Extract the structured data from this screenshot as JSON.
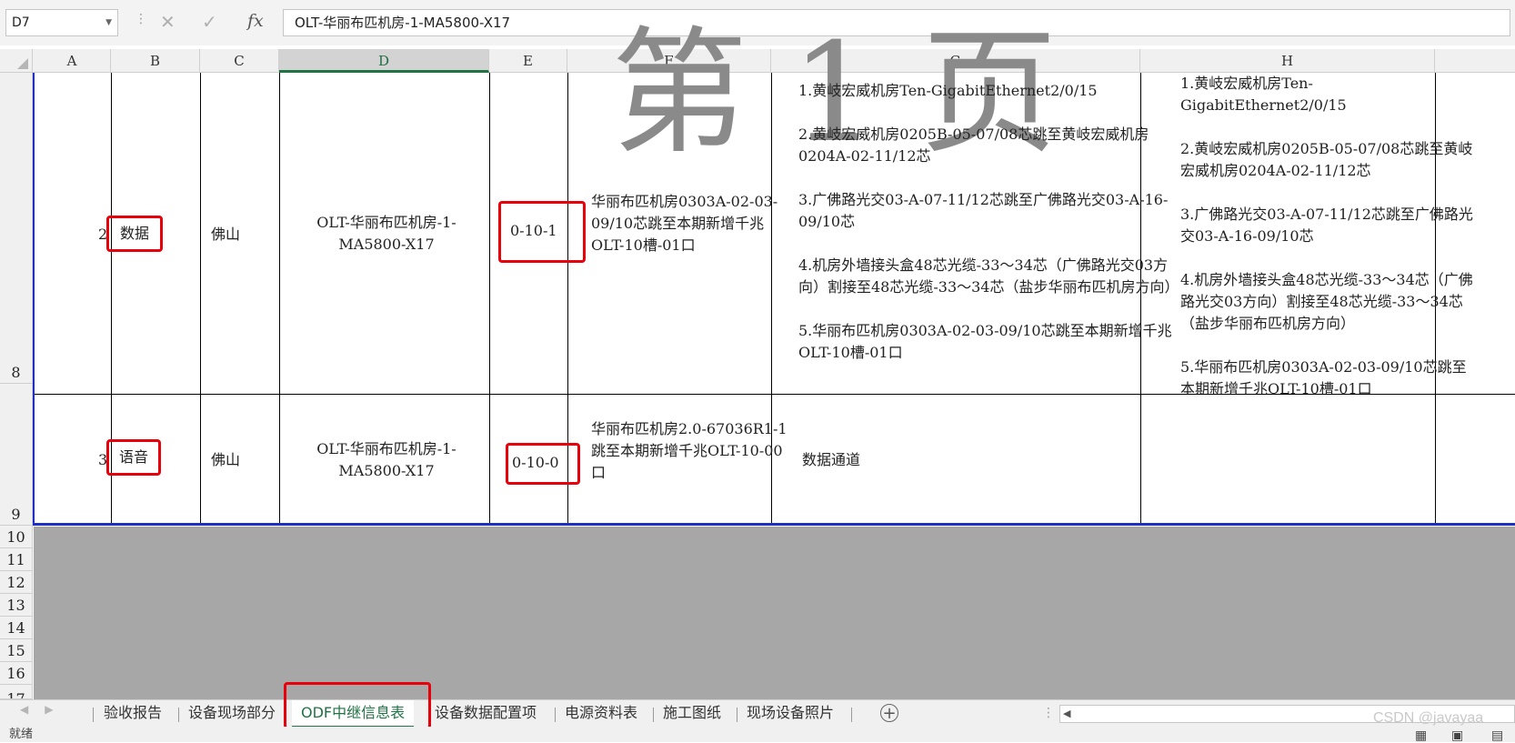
{
  "formula_bar": {
    "name_box": "D7",
    "cancel_icon": "✕",
    "enter_icon": "✓",
    "fx_label": "fx",
    "formula": "OLT-华丽布匹机房-1-MA5800-X17"
  },
  "columns": [
    "A",
    "B",
    "C",
    "D",
    "E",
    "F",
    "G",
    "H"
  ],
  "rows": {
    "r8": {
      "header": "8",
      "a": "2",
      "b": "数据",
      "c": "佛山",
      "d": "OLT-华丽布匹机房-1-MA5800-X17",
      "e": "0-10-1",
      "f": "华丽布匹机房0303A-02-03-09/10芯跳至本期新增千兆OLT-10槽-01口",
      "g": [
        "1.黄岐宏威机房Ten-GigabitEthernet2/0/15",
        "2.黄岐宏威机房0205B-05-07/08芯跳至黄岐宏威机房0204A-02-11/12芯",
        "3.广佛路光交03-A-07-11/12芯跳至广佛路光交03-A-16-09/10芯",
        "4.机房外墙接头盒48芯光缆-33～34芯（广佛路光交03方向）割接至48芯光缆-33～34芯（盐步华丽布匹机房方向）",
        "5.华丽布匹机房0303A-02-03-09/10芯跳至本期新增千兆OLT-10槽-01口"
      ],
      "h": [
        "1.黄岐宏威机房Ten-GigabitEthernet2/0/15",
        "2.黄岐宏威机房0205B-05-07/08芯跳至黄岐宏威机房0204A-02-11/12芯",
        "3.广佛路光交03-A-07-11/12芯跳至广佛路光交03-A-16-09/10芯",
        "4.机房外墙接头盒48芯光缆-33～34芯（广佛路光交03方向）割接至48芯光缆-33～34芯（盐步华丽布匹机房方向）",
        "5.华丽布匹机房0303A-02-03-09/10芯跳至本期新增千兆OLT-10槽-01口"
      ]
    },
    "r9": {
      "header": "9",
      "a": "3",
      "b": "语音",
      "c": "佛山",
      "d": "OLT-华丽布匹机房-1-MA5800-X17",
      "e": "0-10-0",
      "f": "华丽布匹机房2.0-67036R1-1跳至本期新增千兆OLT-10-00口",
      "g": "数据通道",
      "h": ""
    },
    "empty_headers": [
      "10",
      "11",
      "12",
      "13",
      "14",
      "15",
      "16",
      "17"
    ]
  },
  "watermark": "第 1 页",
  "sheet_tabs": [
    "验收报告",
    "设备现场部分",
    "ODF中继信息表",
    "设备数据配置项",
    "电源资料表",
    "施工图纸",
    "现场设备照片"
  ],
  "active_tab": "ODF中继信息表",
  "add_sheet": "+",
  "status": {
    "ready": "就绪"
  },
  "watermark_text": "CSDN @javayaa",
  "colors": {
    "accent": "#217346",
    "highlight_box": "#e8000b",
    "selection_border": "#1f2ec9"
  }
}
